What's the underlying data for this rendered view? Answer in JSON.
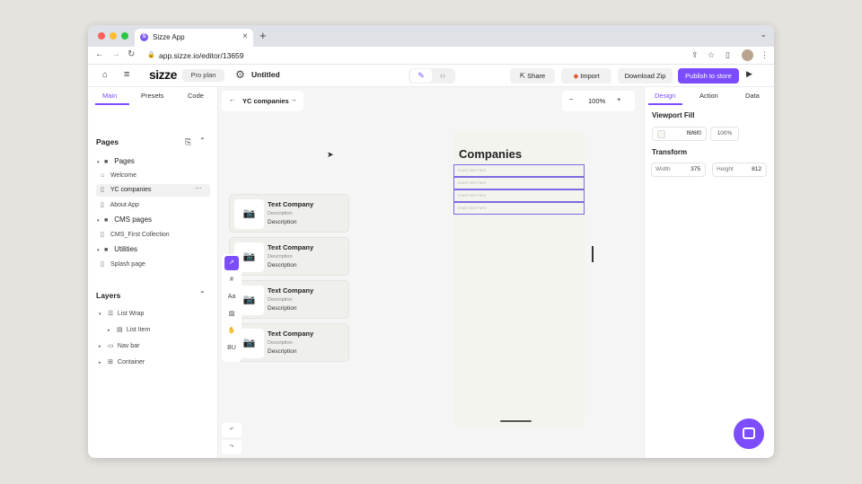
{
  "browser": {
    "tab_title": "Sizze App",
    "tab_close": "×",
    "new_tab": "+",
    "url": "app.sizze.io/editor/13659",
    "colors": {
      "red": "#ff5f57",
      "yellow": "#febc2e",
      "green": "#28c840"
    }
  },
  "appbar": {
    "logo": "sizze",
    "plan": "Pro plan",
    "project_title": "Untitled",
    "share": "Share",
    "import": "Import",
    "download": "Download Zip",
    "publish": "Publish to store",
    "accent": "#7c4dff"
  },
  "sidebar": {
    "tabs": [
      "Main",
      "Presets",
      "Code"
    ],
    "pages_title": "Pages",
    "pages": [
      {
        "label": "Pages",
        "type": "folder"
      },
      {
        "label": "Welcome",
        "type": "home"
      },
      {
        "label": "YC companies",
        "type": "page",
        "selected": true
      },
      {
        "label": "About App",
        "type": "page"
      },
      {
        "label": "CMS pages",
        "type": "folder"
      },
      {
        "label": "CMS_First Collection",
        "type": "page"
      },
      {
        "label": "Utilities",
        "type": "folder"
      },
      {
        "label": "Splash page",
        "type": "page"
      }
    ],
    "layers_title": "Layers",
    "layers": [
      "List Wrap",
      "List Item",
      "Nav bar",
      "Container"
    ]
  },
  "canvas": {
    "breadcrumb": "YC companies",
    "zoom": "100%",
    "cards": [
      {
        "title": "Text Company",
        "desc_small": "Description",
        "desc": "Description"
      },
      {
        "title": "Text Company",
        "desc_small": "Description",
        "desc": "Description"
      },
      {
        "title": "Text Company",
        "desc_small": "Description",
        "desc": "Description"
      },
      {
        "title": "Text Company",
        "desc_small": "Description",
        "desc": "Description"
      }
    ],
    "phone_title": "Companies",
    "phone_rows": [
      "Insert item here",
      "Insert item here",
      "Insert item here",
      "Insert item here"
    ],
    "tools": [
      "select",
      "frame",
      "Aa",
      "image",
      "hand",
      "B U"
    ]
  },
  "rpanel": {
    "tabs": [
      "Design",
      "Action",
      "Data"
    ],
    "viewport_title": "Viewport Fill",
    "fill_hex": "f6f6f0",
    "fill_opacity": "100%",
    "transform_title": "Transform",
    "width_label": "Width",
    "width_value": "375",
    "height_label": "Height",
    "height_value": "812"
  }
}
